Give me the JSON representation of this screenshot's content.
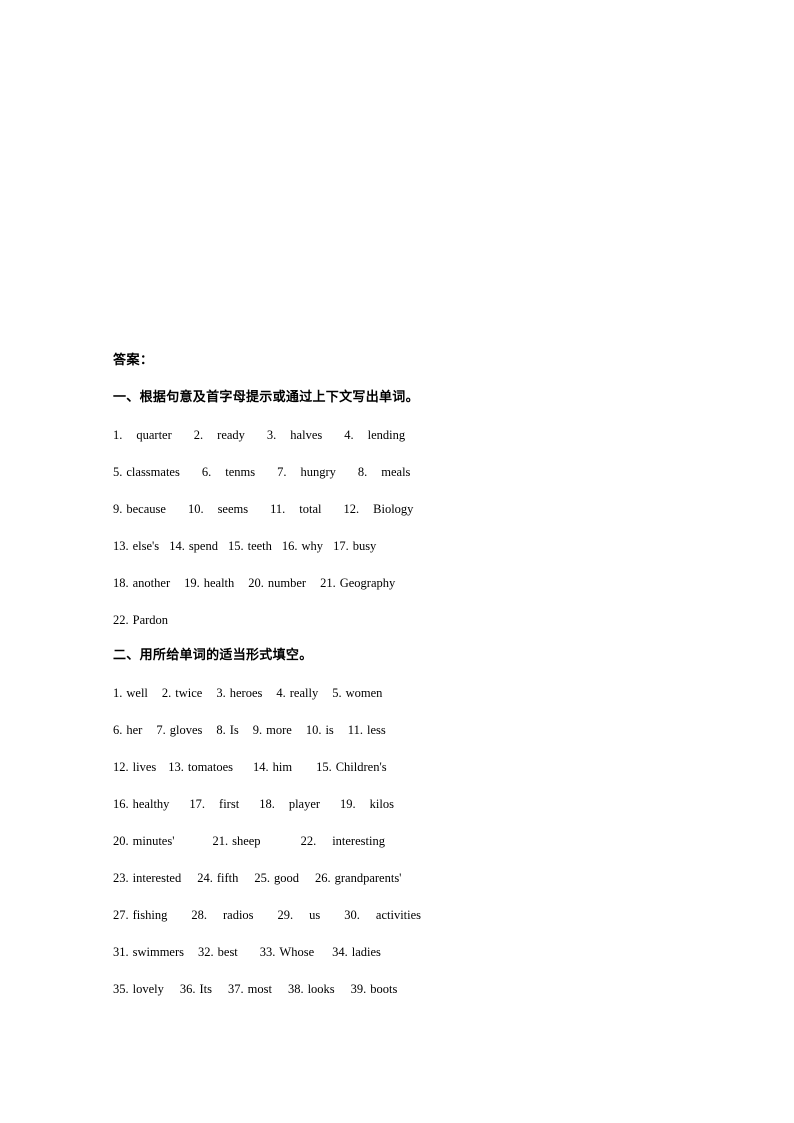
{
  "document": {
    "title": "答案：",
    "background_color": "#ffffff",
    "text_color": "#000000"
  },
  "sections": [
    {
      "heading": "一、根据句意及首字母提示或通过上下文写出单词。",
      "lines": [
        {
          "items": [
            {
              "num": "1.",
              "word": "quarter",
              "num_gap": 14,
              "item_gap": 22
            },
            {
              "num": "2.",
              "word": "ready",
              "num_gap": 14,
              "item_gap": 22
            },
            {
              "num": "3.",
              "word": "halves",
              "num_gap": 14,
              "item_gap": 22
            },
            {
              "num": "4.",
              "word": "lending",
              "num_gap": 14,
              "item_gap": 0
            }
          ]
        },
        {
          "items": [
            {
              "num": "5.",
              "word": "classmates",
              "num_gap": 4,
              "item_gap": 22
            },
            {
              "num": "6.",
              "word": "tenms",
              "num_gap": 14,
              "item_gap": 22
            },
            {
              "num": "7.",
              "word": "hungry",
              "num_gap": 14,
              "item_gap": 22
            },
            {
              "num": "8.",
              "word": "meals",
              "num_gap": 14,
              "item_gap": 0
            }
          ]
        },
        {
          "items": [
            {
              "num": "9.",
              "word": "because",
              "num_gap": 4,
              "item_gap": 22
            },
            {
              "num": "10.",
              "word": "seems",
              "num_gap": 14,
              "item_gap": 22
            },
            {
              "num": "11.",
              "word": "total",
              "num_gap": 14,
              "item_gap": 22
            },
            {
              "num": "12.",
              "word": "Biology",
              "num_gap": 14,
              "item_gap": 0
            }
          ]
        },
        {
          "items": [
            {
              "num": "13.",
              "word": "else's",
              "num_gap": 4,
              "item_gap": 10
            },
            {
              "num": "14.",
              "word": "spend",
              "num_gap": 4,
              "item_gap": 10
            },
            {
              "num": "15.",
              "word": "teeth",
              "num_gap": 4,
              "item_gap": 10
            },
            {
              "num": "16.",
              "word": "why",
              "num_gap": 4,
              "item_gap": 10
            },
            {
              "num": "17.",
              "word": "busy",
              "num_gap": 4,
              "item_gap": 0
            }
          ]
        },
        {
          "items": [
            {
              "num": "18.",
              "word": "another",
              "num_gap": 4,
              "item_gap": 14
            },
            {
              "num": "19.",
              "word": "health",
              "num_gap": 4,
              "item_gap": 14
            },
            {
              "num": "20.",
              "word": "number",
              "num_gap": 4,
              "item_gap": 14
            },
            {
              "num": "21.",
              "word": "Geography",
              "num_gap": 4,
              "item_gap": 0
            }
          ]
        },
        {
          "items": [
            {
              "num": "22.",
              "word": "Pardon",
              "num_gap": 4,
              "item_gap": 0
            }
          ]
        }
      ]
    },
    {
      "heading": "二、用所给单词的适当形式填空。",
      "lines": [
        {
          "items": [
            {
              "num": "1.",
              "word": "well",
              "num_gap": 4,
              "item_gap": 14
            },
            {
              "num": "2.",
              "word": "twice",
              "num_gap": 4,
              "item_gap": 14
            },
            {
              "num": "3.",
              "word": "heroes",
              "num_gap": 4,
              "item_gap": 14
            },
            {
              "num": "4.",
              "word": "really",
              "num_gap": 4,
              "item_gap": 14
            },
            {
              "num": "5.",
              "word": "women",
              "num_gap": 4,
              "item_gap": 0
            }
          ]
        },
        {
          "items": [
            {
              "num": "6.",
              "word": "her",
              "num_gap": 4,
              "item_gap": 14
            },
            {
              "num": "7.",
              "word": "gloves",
              "num_gap": 4,
              "item_gap": 14
            },
            {
              "num": "8.",
              "word": "Is",
              "num_gap": 4,
              "item_gap": 14
            },
            {
              "num": "9.",
              "word": "more",
              "num_gap": 4,
              "item_gap": 14
            },
            {
              "num": "10.",
              "word": "is",
              "num_gap": 4,
              "item_gap": 14
            },
            {
              "num": "11.",
              "word": "less",
              "num_gap": 4,
              "item_gap": 0
            }
          ]
        },
        {
          "items": [
            {
              "num": "12.",
              "word": "lives",
              "num_gap": 4,
              "item_gap": 12
            },
            {
              "num": "13.",
              "word": "tomatoes",
              "num_gap": 4,
              "item_gap": 20
            },
            {
              "num": "14.",
              "word": "him",
              "num_gap": 4,
              "item_gap": 24
            },
            {
              "num": "15.",
              "word": "Children's",
              "num_gap": 4,
              "item_gap": 0
            }
          ]
        },
        {
          "items": [
            {
              "num": "16.",
              "word": "healthy",
              "num_gap": 4,
              "item_gap": 20
            },
            {
              "num": "17.",
              "word": "first",
              "num_gap": 14,
              "item_gap": 20
            },
            {
              "num": "18.",
              "word": "player",
              "num_gap": 14,
              "item_gap": 20
            },
            {
              "num": "19.",
              "word": "kilos",
              "num_gap": 14,
              "item_gap": 0
            }
          ]
        },
        {
          "items": [
            {
              "num": "20.",
              "word": "minutes'",
              "num_gap": 4,
              "item_gap": 38
            },
            {
              "num": "21.",
              "word": "sheep",
              "num_gap": 4,
              "item_gap": 40
            },
            {
              "num": "22.",
              "word": "interesting",
              "num_gap": 16,
              "item_gap": 0
            }
          ]
        },
        {
          "items": [
            {
              "num": "23.",
              "word": "interested",
              "num_gap": 4,
              "item_gap": 16
            },
            {
              "num": "24.",
              "word": "fifth",
              "num_gap": 4,
              "item_gap": 16
            },
            {
              "num": "25.",
              "word": "good",
              "num_gap": 4,
              "item_gap": 16
            },
            {
              "num": "26.",
              "word": "grandparents'",
              "num_gap": 4,
              "item_gap": 0
            }
          ]
        },
        {
          "items": [
            {
              "num": "27.",
              "word": "fishing",
              "num_gap": 4,
              "item_gap": 24
            },
            {
              "num": "28.",
              "word": "radios",
              "num_gap": 16,
              "item_gap": 24
            },
            {
              "num": "29.",
              "word": "us",
              "num_gap": 16,
              "item_gap": 24
            },
            {
              "num": "30.",
              "word": "activities",
              "num_gap": 16,
              "item_gap": 0
            }
          ]
        },
        {
          "items": [
            {
              "num": "31.",
              "word": "swimmers",
              "num_gap": 4,
              "item_gap": 14
            },
            {
              "num": "32.",
              "word": "best",
              "num_gap": 4,
              "item_gap": 22
            },
            {
              "num": "33.",
              "word": "Whose",
              "num_gap": 4,
              "item_gap": 18
            },
            {
              "num": "34.",
              "word": "ladies",
              "num_gap": 4,
              "item_gap": 0
            }
          ]
        },
        {
          "items": [
            {
              "num": "35.",
              "word": "lovely",
              "num_gap": 4,
              "item_gap": 16
            },
            {
              "num": "36.",
              "word": "Its",
              "num_gap": 4,
              "item_gap": 16
            },
            {
              "num": "37.",
              "word": "most",
              "num_gap": 4,
              "item_gap": 16
            },
            {
              "num": "38.",
              "word": "looks",
              "num_gap": 4,
              "item_gap": 16
            },
            {
              "num": "39.",
              "word": "boots",
              "num_gap": 4,
              "item_gap": 0
            }
          ]
        }
      ]
    }
  ]
}
